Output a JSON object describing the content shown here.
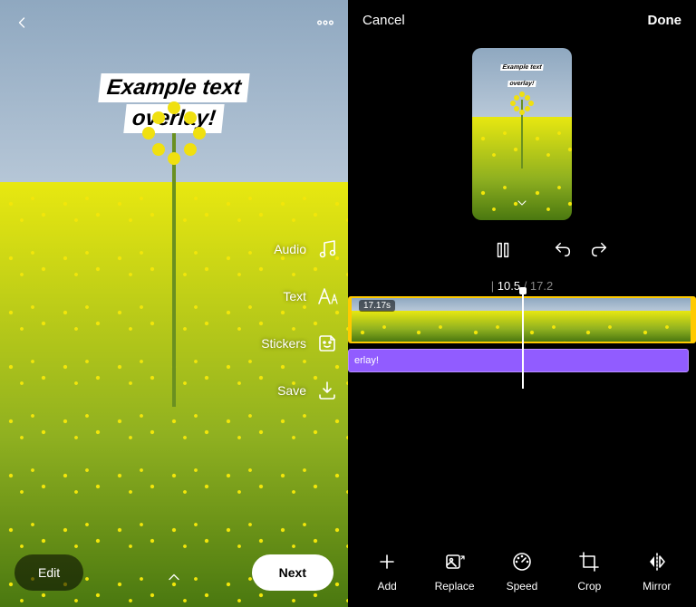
{
  "left": {
    "overlay_line1": "Example text",
    "overlay_line2": "overlay!",
    "tools": {
      "audio": "Audio",
      "text": "Text",
      "stickers": "Stickers",
      "save": "Save"
    },
    "edit_btn": "Edit",
    "next_btn": "Next"
  },
  "right": {
    "cancel": "Cancel",
    "done": "Done",
    "preview_overlay_line1": "Example text",
    "preview_overlay_line2": "overlay!",
    "time_current": "10.5",
    "time_separator": " / ",
    "time_total": "17.2",
    "clip_duration": "17.17s",
    "text_track_label": "erlay!",
    "tools": {
      "add": "Add",
      "replace": "Replace",
      "speed": "Speed",
      "crop": "Crop",
      "mirror": "Mirror"
    }
  }
}
